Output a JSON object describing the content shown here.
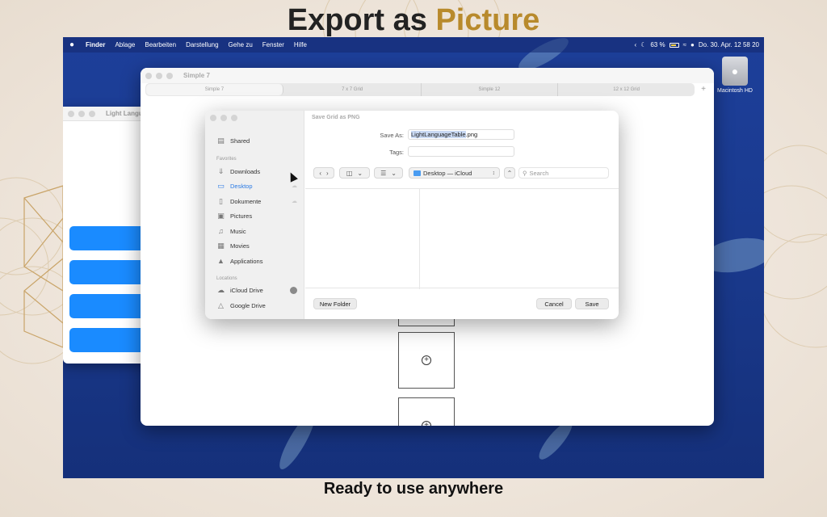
{
  "promo": {
    "title_part1": "Export as",
    "title_part2": "Picture",
    "subtitle": "Ready to use anywhere"
  },
  "menubar": {
    "apple_icon": "apple-icon",
    "items": [
      "Finder",
      "Ablage",
      "Bearbeiten",
      "Darstellung",
      "Gehe zu",
      "Fenster",
      "Hilfe"
    ],
    "battery_percent": "63 %",
    "datetime": "Do. 30. Apr.  12 58 20"
  },
  "desktop": {
    "drive_label": "Macintosh HD"
  },
  "back_window": {
    "title": "Light Langua"
  },
  "main_window": {
    "title": "Simple 7",
    "tabs": [
      "Simple 7",
      "7 x 7 Grid",
      "Simple 12",
      "12 x 12 Grid"
    ],
    "add_tab": "+",
    "cell_icon": "⊕"
  },
  "save_dialog": {
    "title": "Save Grid as PNG",
    "save_as_label": "Save As:",
    "filename_selected": "LightLanguageTable",
    "filename_ext": ".png",
    "tags_label": "Tags:",
    "tags_value": "",
    "location": "Desktop — iCloud",
    "search_placeholder": "Search",
    "sidebar": {
      "shared": "Shared",
      "favorites_header": "Favorites",
      "favorites": [
        {
          "label": "Downloads",
          "icon": "download-icon"
        },
        {
          "label": "Desktop",
          "icon": "desktop-icon",
          "selected": true
        },
        {
          "label": "Dokumente",
          "icon": "document-icon"
        },
        {
          "label": "Pictures",
          "icon": "pictures-icon"
        },
        {
          "label": "Music",
          "icon": "music-icon"
        },
        {
          "label": "Movies",
          "icon": "movies-icon"
        },
        {
          "label": "Applications",
          "icon": "applications-icon"
        }
      ],
      "locations_header": "Locations",
      "locations": [
        {
          "label": "iCloud Drive",
          "icon": "cloud-icon"
        },
        {
          "label": "Google Drive",
          "icon": "drive-icon"
        }
      ]
    },
    "new_folder": "New Folder",
    "cancel": "Cancel",
    "save": "Save"
  }
}
